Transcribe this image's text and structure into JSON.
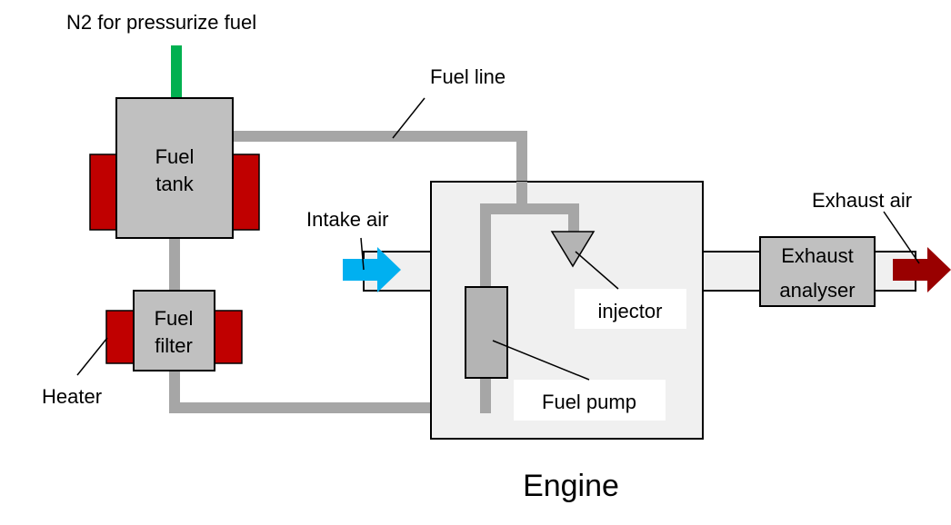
{
  "labels": {
    "n2": "N2 for pressurize fuel",
    "fuel_line": "Fuel line",
    "fuel_tank_1": "Fuel",
    "fuel_tank_2": "tank",
    "fuel_filter_1": "Fuel",
    "fuel_filter_2": "filter",
    "heater": "Heater",
    "intake_air": "Intake air",
    "injector": "injector",
    "fuel_pump": "Fuel pump",
    "exhaust_analyser_1": "Exhaust",
    "exhaust_analyser_2": "analyser",
    "exhaust_air": "Exhaust air",
    "engine": "Engine"
  },
  "colors": {
    "n2_pipe": "#00b050",
    "heater": "#c00000",
    "intake_arrow": "#00b0f0",
    "exhaust_arrow": "#990000",
    "pipe": "#a6a6a6",
    "component": "#c0c0c0",
    "engine": "#f0f0f0"
  }
}
